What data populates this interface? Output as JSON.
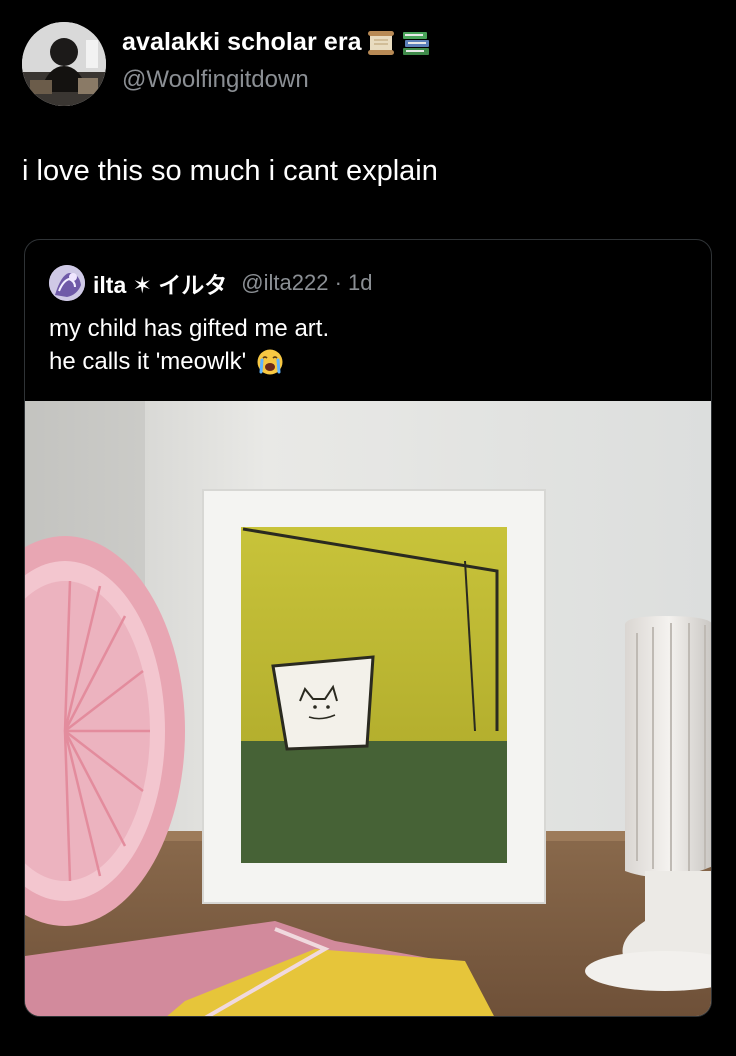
{
  "tweet": {
    "display_name": "avalakki scholar era",
    "name_emojis": [
      "scroll-icon",
      "books-icon"
    ],
    "handle": "@Woolfingitdown",
    "text": "i love this so much i cant explain"
  },
  "quoted_tweet": {
    "display_name": "ilta ✶ イルタ",
    "handle": "@ilta222",
    "separator": "·",
    "time": "1d",
    "lines": [
      "my child has gifted me art.",
      "he calls it 'meowlk'"
    ],
    "trailing_emoji": "crying-face-icon",
    "photo_description_icon": "framed-drawing-photo"
  },
  "colors": {
    "background": "#000000",
    "primary_text": "#ffffff",
    "secondary_text": "#8b8f94",
    "border": "#2f3336"
  }
}
